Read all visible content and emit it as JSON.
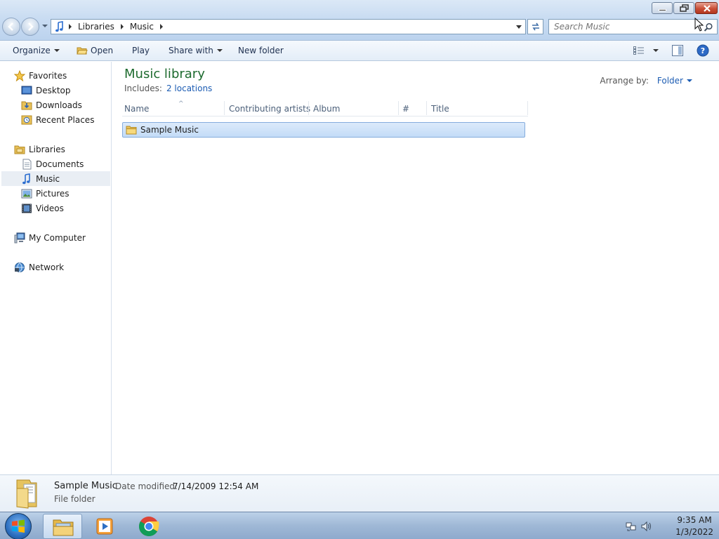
{
  "window": {
    "breadcrumb": [
      "Libraries",
      "Music"
    ],
    "search_placeholder": "Search Music",
    "buttons": [
      "minimize",
      "restore",
      "close"
    ]
  },
  "toolbar": {
    "organize": "Organize",
    "open": "Open",
    "play": "Play",
    "share_with": "Share with",
    "new_folder": "New folder"
  },
  "sidebar": {
    "favorites": "Favorites",
    "fav_items": [
      "Desktop",
      "Downloads",
      "Recent Places"
    ],
    "libraries": "Libraries",
    "lib_items": [
      "Documents",
      "Music",
      "Pictures",
      "Videos"
    ],
    "selected": "Music",
    "computer": "My Computer",
    "network": "Network"
  },
  "main": {
    "title": "Music library",
    "includes_label": "Includes:",
    "includes_link": "2 locations",
    "arrange_label": "Arrange by:",
    "arrange_value": "Folder",
    "columns": [
      "Name",
      "Contributing artists",
      "Album",
      "#",
      "Title"
    ],
    "rows": [
      {
        "name": "Sample Music",
        "selected": true
      }
    ]
  },
  "details": {
    "name": "Sample Music",
    "date_label": "Date modified:",
    "date_value": "7/14/2009 12:54 AM",
    "type": "File folder"
  },
  "taskbar": {
    "time": "9:35 AM",
    "date": "1/3/2022",
    "apps": [
      "windows-explorer",
      "media-player",
      "chrome"
    ]
  },
  "colors": {
    "title_green": "#1e6b2f",
    "link_blue": "#1c5cb3",
    "selection": "#c3dcf7"
  }
}
